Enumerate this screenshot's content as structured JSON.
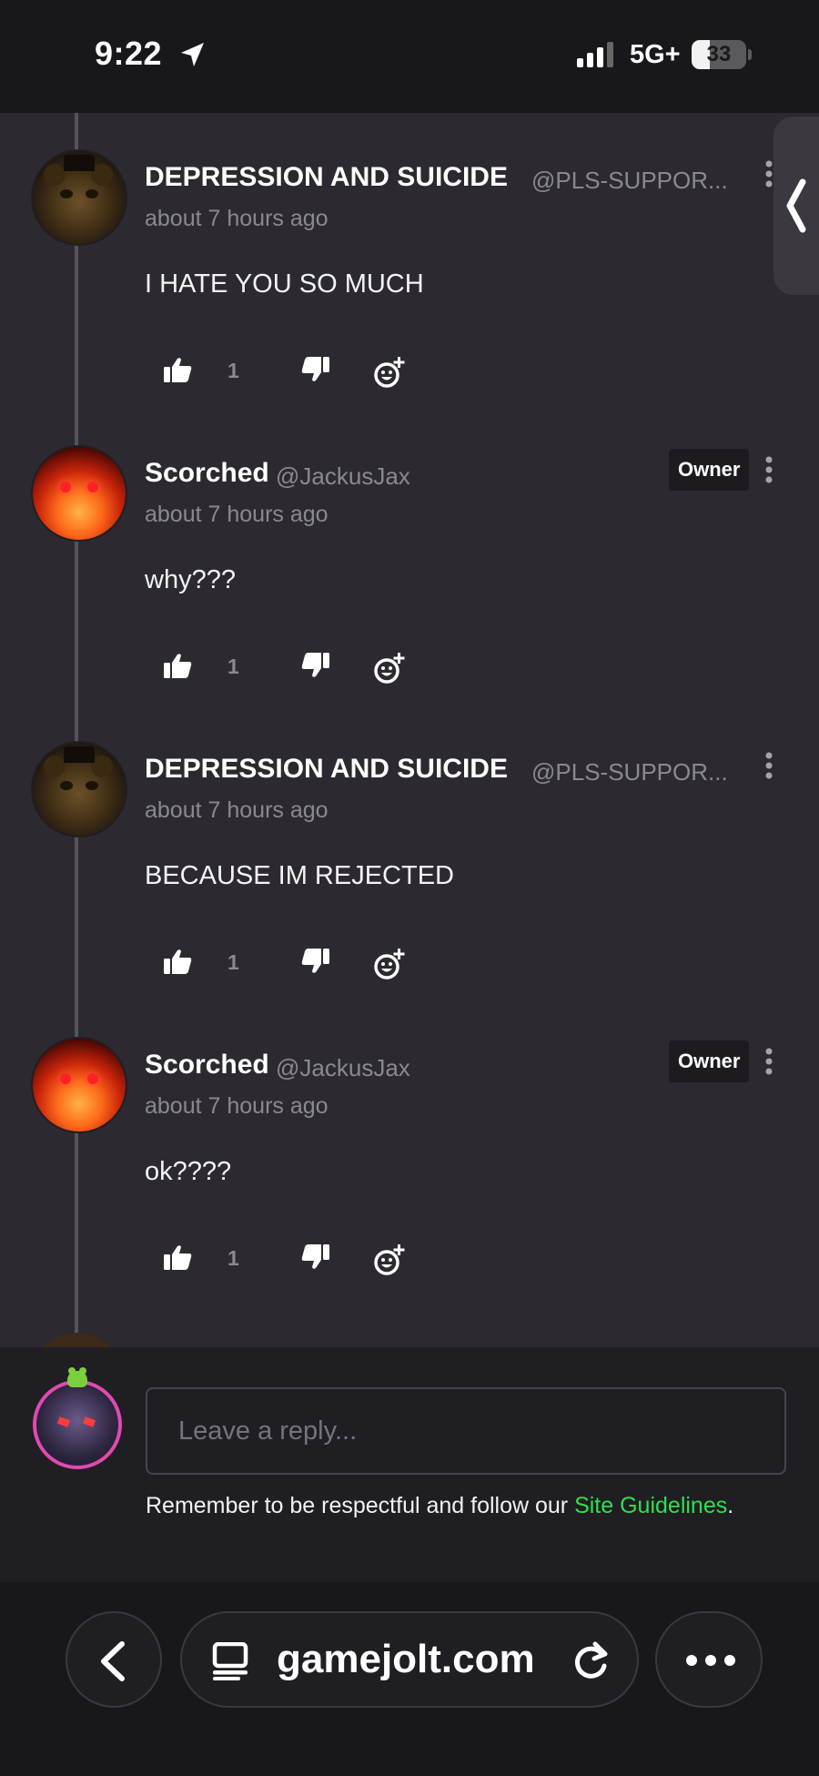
{
  "status_bar": {
    "time": "9:22",
    "network": "5G+",
    "battery_level": "33",
    "battery_fraction": 0.33
  },
  "thread": {
    "comments": [
      {
        "author": "DEPRESSION AND SUICIDE",
        "handle": "@PLS-SUPPOR...",
        "time": "about 7 hours ago",
        "body": "I HATE YOU SO MUCH",
        "likes": "1",
        "badge": ""
      },
      {
        "author": "Scorched",
        "handle": "@JackusJax",
        "time": "about 7 hours ago",
        "body": "why???",
        "likes": "1",
        "badge": "Owner"
      },
      {
        "author": "DEPRESSION AND SUICIDE",
        "handle": "@PLS-SUPPOR...",
        "time": "about 7 hours ago",
        "body": "BECAUSE IM REJECTED",
        "likes": "1",
        "badge": ""
      },
      {
        "author": "Scorched",
        "handle": "@JackusJax",
        "time": "about 7 hours ago",
        "body": "ok????",
        "likes": "1",
        "badge": "Owner"
      }
    ]
  },
  "reply": {
    "placeholder": "Leave a reply...",
    "guidelines_text": "Remember to be respectful and follow our ",
    "guidelines_link": "Site Guidelines",
    "guidelines_end": "."
  },
  "browser": {
    "url": "gamejolt.com"
  },
  "colors": {
    "thread_bg": "#2c2930",
    "link_green": "#2fe04c",
    "owner_badge_bg": "#1d1b20",
    "avatar_ring": "#e04ab0"
  },
  "icons": {
    "like": "thumbs-up-icon",
    "dislike": "thumbs-down-icon",
    "react": "add-reaction-icon",
    "more": "more-vertical-icon"
  }
}
